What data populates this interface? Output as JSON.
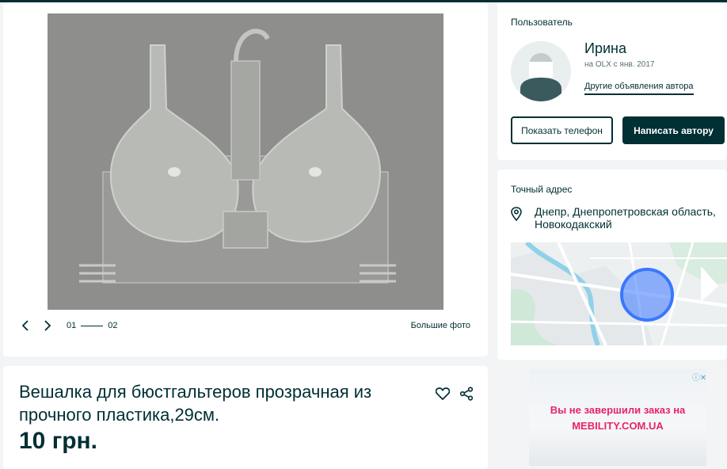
{
  "gallery": {
    "pager_current": "01",
    "pager_total": "02",
    "big_photo_label": "Большие фото"
  },
  "listing": {
    "title": "Вешалка для бюстгальтеров прозрачная из прочного пластика,29см.",
    "price": "10 грн."
  },
  "user": {
    "section_label": "Пользователь",
    "name": "Ирина",
    "since": "на OLX с янв. 2017",
    "other_ads_label": "Другие объявления автора",
    "show_phone_label": "Показать телефон",
    "write_author_label": "Написать автору"
  },
  "address": {
    "section_label": "Точный адрес",
    "text": "Днепр, Днепропетровская область, Новокодакский"
  },
  "ad_banner": {
    "line1": "Вы не завершили заказ на",
    "line2": "MEBILITY.COM.UA",
    "close_glyph": "ⓘ✕"
  },
  "colors": {
    "brand_dark": "#002f34",
    "banner_accent": "#e7236b",
    "map_marker": "#3a77ff"
  },
  "icons": [
    "chevron-left-icon",
    "chevron-right-icon",
    "heart-icon",
    "share-icon",
    "location-pin-icon"
  ]
}
